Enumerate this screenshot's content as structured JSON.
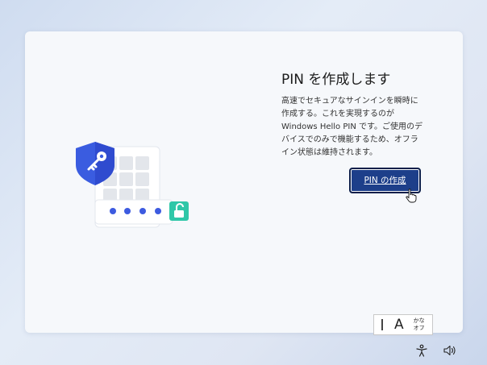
{
  "setup": {
    "title": "PIN を作成します",
    "description_lines": [
      "高速でセキュアなサインインを瞬時に",
      "作成する。これを実現するのが",
      "Windows Hello PIN です。ご使用のデ",
      "バイスでのみで機能するため、オフラ",
      "イン状態は維持されます。"
    ],
    "create_pin_label": "PIN の作成"
  },
  "ime": {
    "mode_glyph": "A",
    "kana_top": "かな",
    "kana_bottom": "オフ"
  },
  "icons": {
    "shield": "shield-key-icon",
    "keypad": "keypad-icon",
    "unlock": "unlock-icon",
    "accessibility": "accessibility-icon",
    "volume": "volume-icon",
    "cursor": "hand-cursor-icon"
  },
  "colors": {
    "button": "#1d3f8a",
    "shield": "#3a5ce0",
    "unlock": "#2fc7a8",
    "dots": "#3d5be0"
  }
}
